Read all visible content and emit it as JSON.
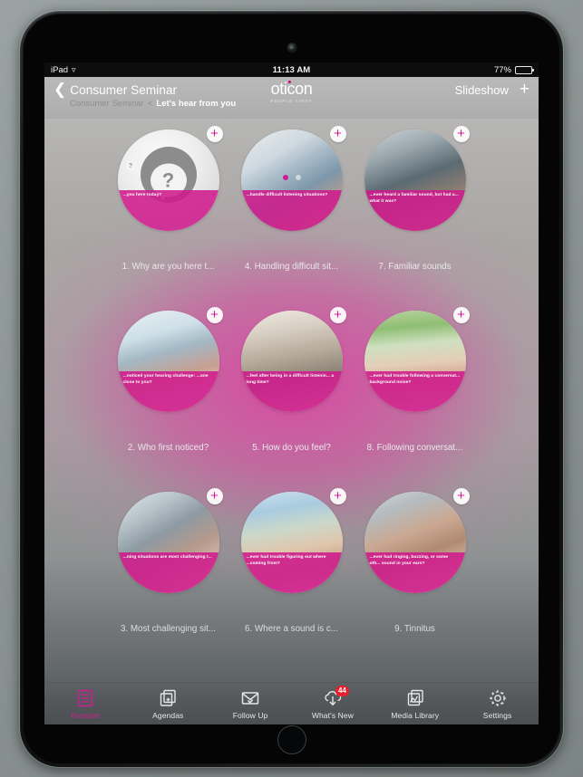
{
  "status_bar": {
    "carrier": "iPad",
    "wifi_icon": "wifi-icon",
    "time": "11:13 AM",
    "battery_percent": "77%"
  },
  "nav": {
    "back_icon": "chevron-left-icon",
    "title": "Consumer Seminar",
    "slideshow_label": "Slideshow",
    "add_icon": "plus-icon",
    "logo_word": "oticon",
    "logo_tagline": "PEOPLE FIRST",
    "breadcrumb": {
      "root": "Consumer Seminar",
      "separator": "<",
      "current": "Let's hear from you"
    }
  },
  "pagination": {
    "total": 2,
    "active_index": 0,
    "active_color": "#cc1f8f"
  },
  "theme": {
    "accent": "#cc1f8f",
    "caption_bg": "rgba(206,26,140,0.88)",
    "badge_red": "#e8202a"
  },
  "grid": {
    "rows": [
      {
        "cards": [
          {
            "label": "1. Why are you here t...",
            "caption": "...you here today?",
            "thumb_kind": "question-placeholder",
            "add_icon": "plus-icon"
          },
          {
            "label": "4. Handling difficult sit...",
            "caption": "...handle difficult listening situations?",
            "thumb_kind": "photo-man-hand",
            "add_icon": "plus-icon"
          },
          {
            "label": "7. Familiar sounds",
            "caption": "...ever heard a familiar sound, but had a... what it was?",
            "thumb_kind": "photo-laptop",
            "add_icon": "plus-icon"
          }
        ]
      },
      {
        "cards": [
          {
            "label": "2. Who first noticed?",
            "caption": "...noticed your hearing challenge: ...one close to you?",
            "thumb_kind": "photo-couple",
            "add_icon": "plus-icon"
          },
          {
            "label": "5. How do you feel?",
            "caption": "...feel after being in a difficult listenin... a long time?",
            "thumb_kind": "photo-restaurant",
            "add_icon": "plus-icon"
          },
          {
            "label": "8. Following conversat...",
            "caption": "...ever had trouble following a conversat... background noise?",
            "thumb_kind": "photo-family",
            "add_icon": "plus-icon"
          }
        ]
      },
      {
        "cards": [
          {
            "label": "3. Most challenging sit...",
            "caption": "...ning situations are most challenging t...",
            "thumb_kind": "photo-group",
            "add_icon": "plus-icon"
          },
          {
            "label": "6. Where a sound is c...",
            "caption": "...ever had trouble figuring out where ...coming from?",
            "thumb_kind": "photo-outdoor",
            "add_icon": "plus-icon"
          },
          {
            "label": "9. Tinnitus",
            "caption": "...ever had ringing, buzzing, or some oth... sound in your ears?",
            "thumb_kind": "photo-tinnitus",
            "add_icon": "plus-icon"
          }
        ]
      }
    ]
  },
  "tab_bar": {
    "tabs": [
      {
        "label": "Browser",
        "icon": "browser-icon",
        "active": true,
        "badge": null
      },
      {
        "label": "Agendas",
        "icon": "agendas-icon",
        "active": false,
        "badge": null
      },
      {
        "label": "Follow Up",
        "icon": "envelope-check-icon",
        "active": false,
        "badge": null
      },
      {
        "label": "What's New",
        "icon": "cloud-download-icon",
        "active": false,
        "badge": "44"
      },
      {
        "label": "Media Library",
        "icon": "media-library-icon",
        "active": false,
        "badge": null
      },
      {
        "label": "Settings",
        "icon": "gear-icon",
        "active": false,
        "badge": null
      }
    ]
  }
}
